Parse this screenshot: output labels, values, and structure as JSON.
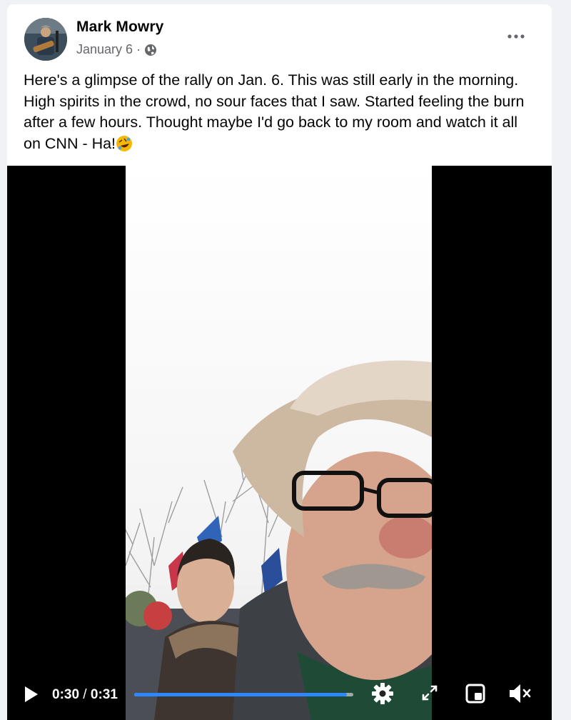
{
  "post": {
    "author": "Mark Mowry",
    "date": "January 6",
    "separator": "·",
    "privacy_icon": "globe-icon",
    "more_icon": "more-options-icon",
    "text": "Here's a glimpse of the rally on Jan. 6. This was still early in the morning. High spirits in the crowd, no sour faces that I saw. Started feeling the burn after a few hours. Thought maybe I'd go back to my room and watch it all on CNN - Ha!",
    "emoji": "rolling-on-floor-laughing-emoji"
  },
  "video": {
    "current_time": "0:30",
    "time_separator": " / ",
    "duration": "0:31",
    "progress": 0.97,
    "progress_color": "#2d88ff",
    "icons": [
      "play-icon",
      "settings-gear-icon",
      "fullscreen-icon",
      "picture-in-picture-icon",
      "volume-muted-icon"
    ]
  }
}
